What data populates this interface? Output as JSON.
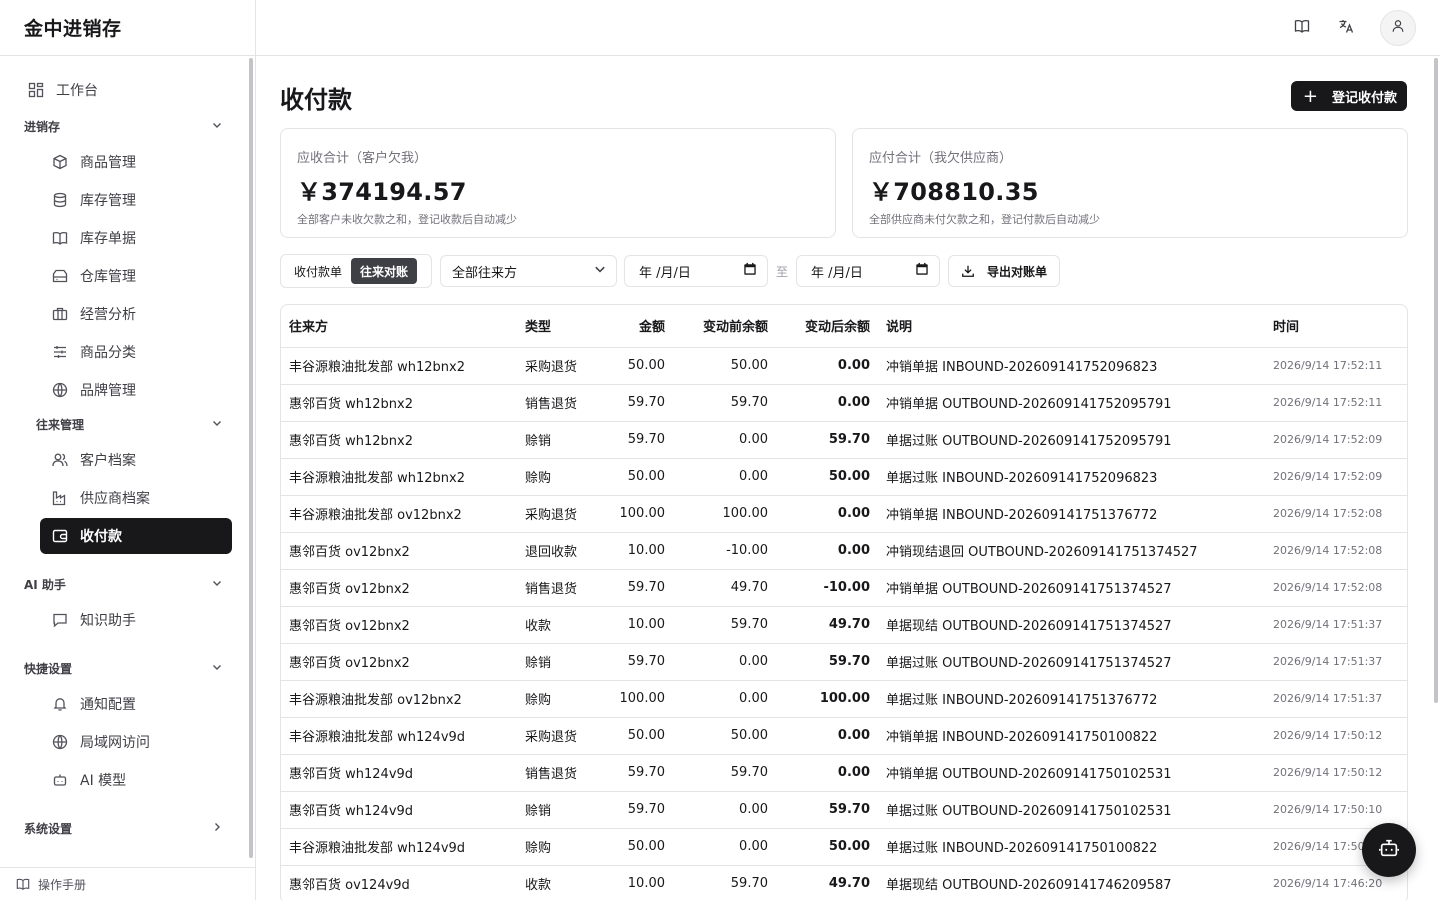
{
  "app": {
    "title": "金中进销存"
  },
  "sidebar": {
    "workbench": "工作台",
    "group_inventory": "进销存",
    "products": "商品管理",
    "stock": "库存管理",
    "stock_docs": "库存单据",
    "warehouse": "仓库管理",
    "analysis": "经营分析",
    "category": "商品分类",
    "brand": "品牌管理",
    "group_partners": "往来管理",
    "customers": "客户档案",
    "suppliers": "供应商档案",
    "payments": "收付款",
    "group_ai": "AI 助手",
    "knowledge": "知识助手",
    "group_quick": "快捷设置",
    "notify": "通知配置",
    "lan": "局域网访问",
    "ai_model": "AI 模型",
    "group_system": "系统设置",
    "manual": "操作手册"
  },
  "page": {
    "title": "收付款",
    "add_button": "登记收付款"
  },
  "summary": {
    "receivable": {
      "title": "应收合计（客户欠我）",
      "amount": "￥374194.57",
      "note": "全部客户未收欠款之和，登记收款后自动减少"
    },
    "payable": {
      "title": "应付合计（我欠供应商）",
      "amount": "￥708810.35",
      "note": "全部供应商未付欠款之和，登记付款后自动减少"
    }
  },
  "filters": {
    "tab_list": "收付款单",
    "tab_reconcile": "往来对账",
    "party_select": "全部往来方",
    "date_from": "年 /月/日",
    "date_to": "年 /月/日",
    "to_label": "至",
    "export": "导出对账单"
  },
  "table": {
    "headers": [
      "往来方",
      "类型",
      "金额",
      "变动前余额",
      "变动后余额",
      "说明",
      "时间"
    ],
    "rows": [
      [
        "丰谷源粮油批发部 wh12bnx2",
        "采购退货",
        "50.00",
        "50.00",
        "0.00",
        "冲销单据 INBOUND-202609141752096823",
        "2026/9/14 17:52:11"
      ],
      [
        "惠邻百货 wh12bnx2",
        "销售退货",
        "59.70",
        "59.70",
        "0.00",
        "冲销单据 OUTBOUND-202609141752095791",
        "2026/9/14 17:52:11"
      ],
      [
        "惠邻百货 wh12bnx2",
        "赊销",
        "59.70",
        "0.00",
        "59.70",
        "单据过账 OUTBOUND-202609141752095791",
        "2026/9/14 17:52:09"
      ],
      [
        "丰谷源粮油批发部 wh12bnx2",
        "赊购",
        "50.00",
        "0.00",
        "50.00",
        "单据过账 INBOUND-202609141752096823",
        "2026/9/14 17:52:09"
      ],
      [
        "丰谷源粮油批发部 ov12bnx2",
        "采购退货",
        "100.00",
        "100.00",
        "0.00",
        "冲销单据 INBOUND-202609141751376772",
        "2026/9/14 17:52:08"
      ],
      [
        "惠邻百货 ov12bnx2",
        "退回收款",
        "10.00",
        "-10.00",
        "0.00",
        "冲销现结退回 OUTBOUND-202609141751374527",
        "2026/9/14 17:52:08"
      ],
      [
        "惠邻百货 ov12bnx2",
        "销售退货",
        "59.70",
        "49.70",
        "-10.00",
        "冲销单据 OUTBOUND-202609141751374527",
        "2026/9/14 17:52:08"
      ],
      [
        "惠邻百货 ov12bnx2",
        "收款",
        "10.00",
        "59.70",
        "49.70",
        "单据现结 OUTBOUND-202609141751374527",
        "2026/9/14 17:51:37"
      ],
      [
        "惠邻百货 ov12bnx2",
        "赊销",
        "59.70",
        "0.00",
        "59.70",
        "单据过账 OUTBOUND-202609141751374527",
        "2026/9/14 17:51:37"
      ],
      [
        "丰谷源粮油批发部 ov12bnx2",
        "赊购",
        "100.00",
        "0.00",
        "100.00",
        "单据过账 INBOUND-202609141751376772",
        "2026/9/14 17:51:37"
      ],
      [
        "丰谷源粮油批发部 wh124v9d",
        "采购退货",
        "50.00",
        "50.00",
        "0.00",
        "冲销单据 INBOUND-202609141750100822",
        "2026/9/14 17:50:12"
      ],
      [
        "惠邻百货 wh124v9d",
        "销售退货",
        "59.70",
        "59.70",
        "0.00",
        "冲销单据 OUTBOUND-202609141750102531",
        "2026/9/14 17:50:12"
      ],
      [
        "惠邻百货 wh124v9d",
        "赊销",
        "59.70",
        "0.00",
        "59.70",
        "单据过账 OUTBOUND-202609141750102531",
        "2026/9/14 17:50:10"
      ],
      [
        "丰谷源粮油批发部 wh124v9d",
        "赊购",
        "50.00",
        "0.00",
        "50.00",
        "单据过账 INBOUND-202609141750100822",
        "2026/9/14 17:50:"
      ],
      [
        "惠邻百货 ov124v9d",
        "收款",
        "10.00",
        "59.70",
        "49.70",
        "单据现结 OUTBOUND-202609141746209587",
        "2026/9/14 17:46:20"
      ]
    ]
  },
  "colors": {
    "primary": "#18181b",
    "border": "#e4e4e7",
    "muted": "#71717a"
  }
}
